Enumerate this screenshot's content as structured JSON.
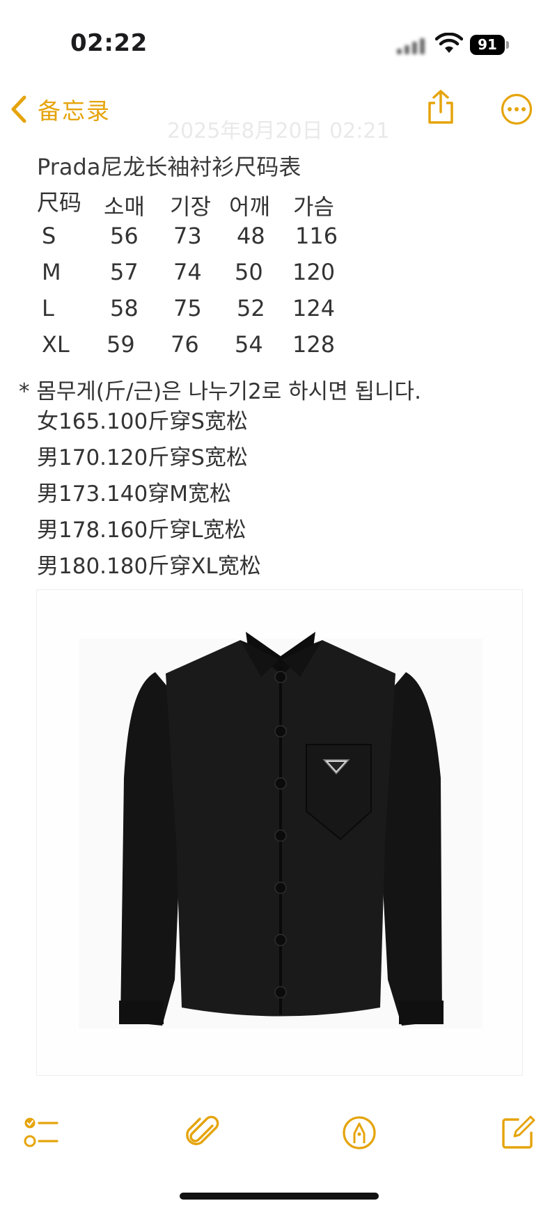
{
  "status_bar": {
    "time": "02:22",
    "battery": "91"
  },
  "nav": {
    "back_label": "备忘录",
    "ghost_date": "2025年8月20日 02:21"
  },
  "note": {
    "title": "Prada尼龙长袖衬衫尺码表",
    "table": {
      "headers": [
        "尺码",
        "소매",
        "기장",
        "어깨",
        "가슴"
      ],
      "rows": [
        [
          "S",
          "56",
          "73",
          "48",
          "116"
        ],
        [
          "M",
          "57",
          "74",
          "50",
          "120"
        ],
        [
          "L",
          "58",
          "75",
          "52",
          "124"
        ],
        [
          "XL",
          "59",
          "76",
          "54",
          "128"
        ]
      ]
    },
    "footnote": "* 몸무게(斤/근)은 나누기2로 하시면 됩니다.",
    "lines": [
      "女165.100斤穿S宽松",
      "男170.120斤穿S宽松",
      "男173.140穿M宽松",
      "男178.160斤穿L宽松",
      "男180.180斤穿XL宽松"
    ]
  },
  "colors": {
    "accent": "#e5a40b",
    "text": "#333333",
    "shirt": "#151515"
  },
  "icons": {
    "back": "chevron-left-icon",
    "share": "share-icon",
    "more": "ellipsis-circle-icon",
    "checklist": "checklist-icon",
    "attach": "paperclip-icon",
    "markup": "pen-circle-icon",
    "compose": "compose-icon"
  }
}
